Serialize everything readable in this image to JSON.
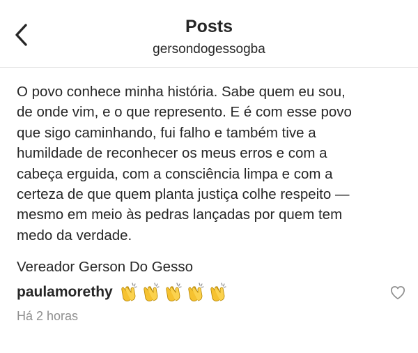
{
  "header": {
    "title": "Posts",
    "username": "gersondogessogba"
  },
  "post": {
    "caption": "O povo conhece minha história. Sabe quem eu sou,\nde onde vim, e o que represento. E é com esse povo\nque sigo caminhando, fui falho e também tive a\nhumildade de reconhecer os meus erros e com a\ncabeça erguida, com a consciência limpa e com a\ncerteza de que quem planta justiça colhe respeito —\nmesmo em meio às pedras lançadas por quem tem\nmedo da verdade.",
    "signature": "Vereador Gerson Do Gesso"
  },
  "comment": {
    "username": "paulamorethy",
    "emoji": [
      "clapping-hands",
      "clapping-hands",
      "clapping-hands",
      "clapping-hands",
      "clapping-hands"
    ],
    "time": "Há 2 horas"
  },
  "icons": {
    "back": "chevron-left",
    "like": "heart-outline"
  },
  "colors": {
    "text": "#262626",
    "secondary": "#8e8e8e",
    "clap": "#f6c230"
  }
}
